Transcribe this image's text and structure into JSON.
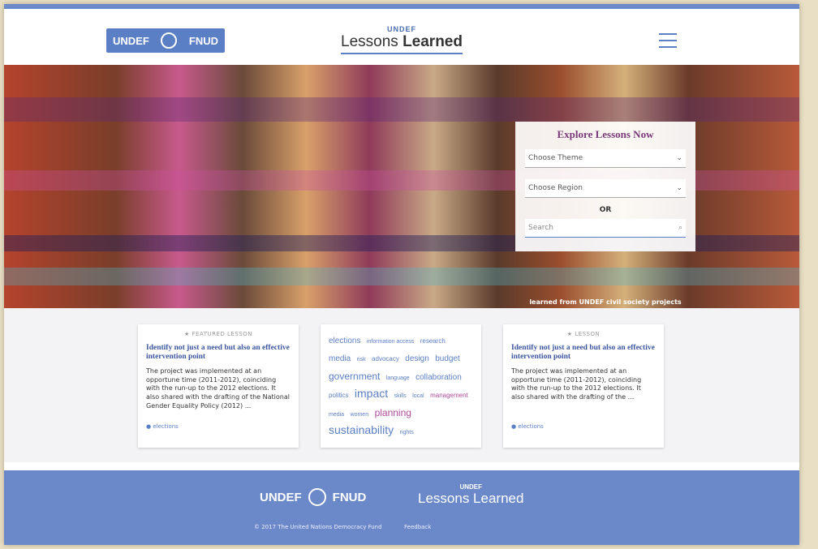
{
  "header": {
    "logo_left": "UNDEF",
    "logo_right": "FNUD",
    "title_small": "UNDEF",
    "title_main_light": "Lessons ",
    "title_main_bold": "Learned"
  },
  "explore": {
    "heading": "Explore Lessons Now",
    "theme_placeholder": "Choose Theme",
    "region_placeholder": "Choose Region",
    "or_label": "OR",
    "search_placeholder": "Search",
    "caption": "learned from UNDEF civil society projects"
  },
  "cards": [
    {
      "badge": "FEATURED LESSON",
      "title": "Identify not just a need but also an effective intervention point",
      "body": "The project was implemented at an opportune time (2011-2012), coinciding with the run-up to the 2012 elections. It also shared with the drafting of the National Gender Equality Policy (2012) ...",
      "tag": "elections"
    },
    {
      "tags": [
        "elections",
        "information access",
        "research",
        "media",
        "risk",
        "advocacy",
        "design",
        "budget",
        "government",
        "language",
        "collaboration",
        "politics",
        "impact",
        "skills",
        "local",
        "management",
        "media",
        "women",
        "planning",
        "sustainability",
        "rights"
      ]
    },
    {
      "badge": "LESSON",
      "title": "Identify not just a need but also an effective intervention point",
      "body": "The project was implemented at an opportune time (2011-2012), coinciding with the run-up to the 2012 elections. It also shared with the drafting of the ...",
      "tag": "elections"
    }
  ],
  "footer": {
    "logo_left": "UNDEF",
    "logo_right": "FNUD",
    "title_small": "UNDEF",
    "title_main": "Lessons Learned",
    "copyright": "© 2017 The United Nations Democracy Fund",
    "feedback": "Feedback"
  },
  "colors": {
    "brand_blue": "#5b7fc4",
    "footer_blue": "#6b88c9",
    "accent_purple": "#7a3a7a"
  }
}
